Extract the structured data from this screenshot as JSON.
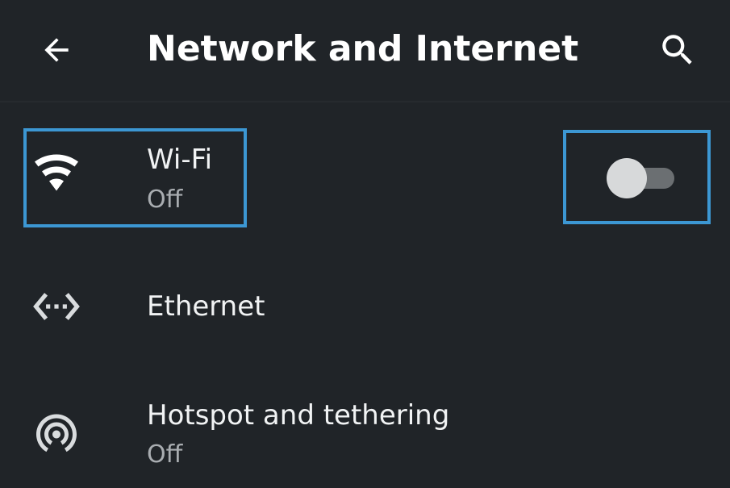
{
  "header": {
    "title": "Network and Internet",
    "back_icon": "arrow-back-icon",
    "search_icon": "search-icon"
  },
  "items": [
    {
      "title": "Wi-Fi",
      "subtitle": "Off",
      "icon": "wifi-icon",
      "toggle": {
        "state": "off"
      }
    },
    {
      "title": "Ethernet",
      "icon": "ethernet-icon"
    },
    {
      "title": "Hotspot and tethering",
      "subtitle": "Off",
      "icon": "hotspot-icon"
    }
  ],
  "colors": {
    "background": "#202428",
    "highlight": "#3c97d3",
    "text_primary": "#f1f3f4",
    "text_secondary": "#a9adb1",
    "toggle_track": "#6b6f72",
    "toggle_thumb": "#d7d9da"
  }
}
